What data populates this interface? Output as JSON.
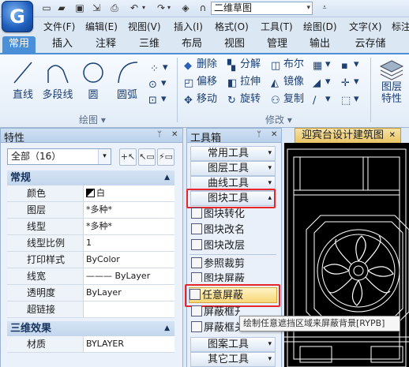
{
  "app": {
    "logo": "G",
    "title_combo": "二维草图"
  },
  "quick_access": [
    "new-icon",
    "open-icon",
    "save-icon",
    "saveas-icon",
    "print-icon",
    "undo-icon",
    "redo-icon",
    "layers-icon",
    "headset-icon"
  ],
  "menu": [
    "文件(F)",
    "编辑(E)",
    "视图(V)",
    "插入(I)",
    "格式(O)",
    "工具(T)",
    "绘图(D)",
    "文字(X)",
    "标注"
  ],
  "tabs": [
    "常用",
    "插入",
    "注释",
    "三维",
    "布局",
    "视图",
    "管理",
    "输出",
    "云存储"
  ],
  "ribbon": {
    "draw": {
      "line": "直线",
      "pline": "多段线",
      "circle": "圆",
      "arc": "圆弧",
      "group": "绘图"
    },
    "modify": {
      "delete": "删除",
      "explode": "分解",
      "boolean": "布尔",
      "offset": "偏移",
      "stretch": "拉伸",
      "mirror": "镜像",
      "move": "移动",
      "rotate": "旋转",
      "copy": "复制",
      "group": "修改"
    },
    "layer_props": "图层\n特性"
  },
  "properties": {
    "title": "特性",
    "selection": "全部（16）",
    "sections": {
      "general": "常规",
      "three_d": "三维效果"
    },
    "rows": [
      {
        "k": "颜色",
        "v": "白"
      },
      {
        "k": "图层",
        "v": "*多种*"
      },
      {
        "k": "线型",
        "v": "*多种*"
      },
      {
        "k": "线型比例",
        "v": "1"
      },
      {
        "k": "打印样式",
        "v": "ByColor"
      },
      {
        "k": "线宽",
        "v": "——— ByLayer"
      },
      {
        "k": "透明度",
        "v": "ByLayer"
      },
      {
        "k": "超链接",
        "v": ""
      }
    ],
    "three_d_rows": [
      {
        "k": "材质",
        "v": "BYLAYER"
      }
    ]
  },
  "toolbox": {
    "title": "工具箱",
    "cats_top": [
      "常用工具",
      "图层工具",
      "曲线工具",
      "图块工具"
    ],
    "items": [
      "图块转化",
      "图块改名",
      "图块改层",
      "参照裁剪",
      "图块屏蔽",
      "任意屏蔽",
      "屏蔽框开",
      "屏蔽框关"
    ],
    "cats_bottom": [
      "图案工具",
      "其它工具"
    ]
  },
  "tooltip": "绘制任意遮挡区域来屏蔽背景[RYPB]",
  "document_tab": "迎宾台设计建筑图",
  "colors": {
    "accent": "#4a8fd8",
    "highlight": "#e8262a",
    "tab_doc": "#e9c563"
  }
}
